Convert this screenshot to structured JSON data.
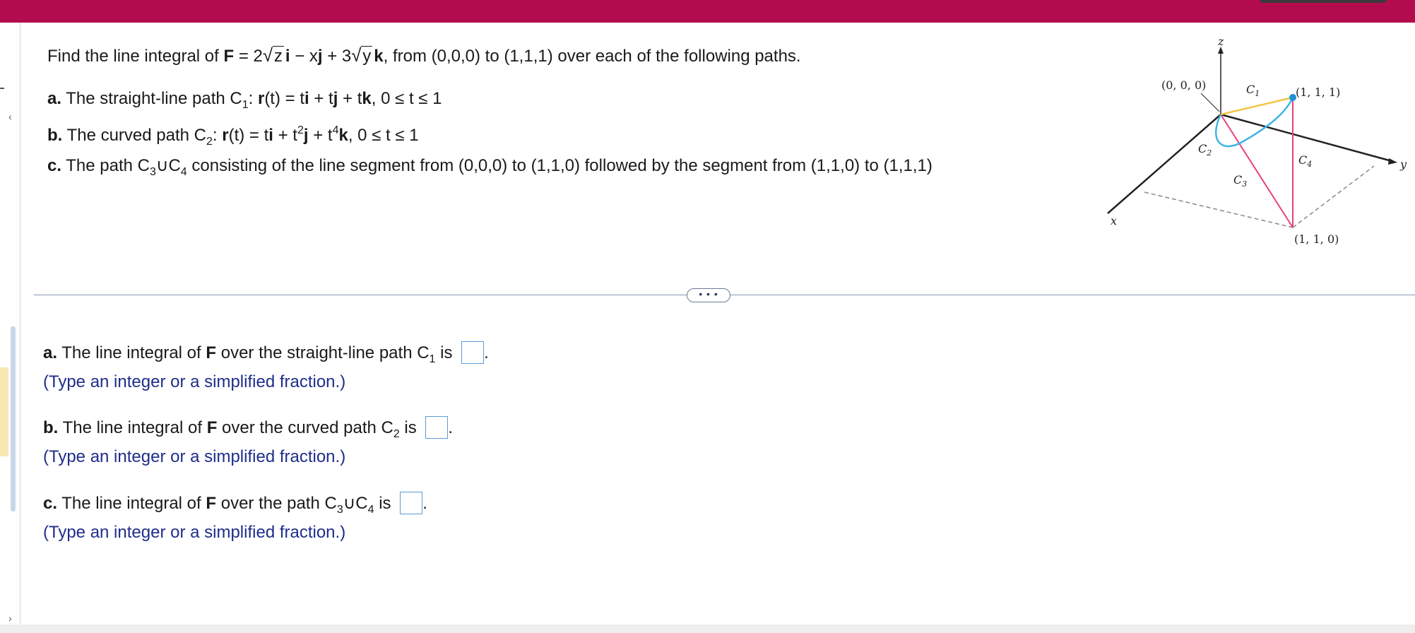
{
  "problem": {
    "intro_pre": "Find the line integral of ",
    "F": "F",
    "eq_a": " = 2",
    "rad_z": "z",
    "i": "i",
    "eq_b": " − x",
    "j": "j",
    "eq_c": " + 3",
    "rad_y": "y",
    "k": "k",
    "intro_post": ", from (0,0,0) to (1,1,1) over each of the following paths.",
    "a_label": "a.",
    "a_text1": " The straight-line path C",
    "a_sub": "1",
    "a_text2": ": ",
    "a_r": "r",
    "a_text3": "(t) = t",
    "a_i": "i",
    "a_text4": " + t",
    "a_j": "j",
    "a_text5": " + t",
    "a_k": "k",
    "a_text6": ", 0 ≤ t ≤ 1",
    "b_label": "b.",
    "b_text1": " The curved path C",
    "b_sub": "2",
    "b_text2": ": ",
    "b_r": "r",
    "b_text3": "(t) = t",
    "b_i": "i",
    "b_text4": " + t",
    "b_sup2": "2",
    "b_j": "j",
    "b_text5": " + t",
    "b_sup4": "4",
    "b_k": "k",
    "b_text6": ", 0 ≤ t ≤ 1",
    "c_label": "c.",
    "c_text1": " The path C",
    "c_sub3": "3",
    "c_union": "∪C",
    "c_sub4": "4",
    "c_text2": " consisting of the line segment from (0,0,0) to (1,1,0) followed by the segment from (1,1,0) to (1,1,1)"
  },
  "more_button": "• • •",
  "answers": {
    "a_label": "a.",
    "a_text1": " The line integral of ",
    "a_F": "F",
    "a_text2": " over the straight-line path C",
    "a_sub": "1",
    "a_text3": " is ",
    "b_label": "b.",
    "b_text1": " The line integral of ",
    "b_F": "F",
    "b_text2": " over the curved path C",
    "b_sub": "2",
    "b_text3": " is ",
    "c_label": "c.",
    "c_text1": " The line integral of ",
    "c_F": "F",
    "c_text2": " over the path C",
    "c_sub3": "3",
    "c_union": "∪C",
    "c_sub4": "4",
    "c_text3": " is ",
    "period": ".",
    "hint": "(Type an integer or a simplified fraction.)"
  },
  "figure": {
    "z": "z",
    "y": "y",
    "x": "x",
    "origin": "(0, 0, 0)",
    "p111": "(1, 1, 1)",
    "p110": "(1, 1, 0)",
    "c1": "C",
    "c1s": "1",
    "c2": "C",
    "c2s": "2",
    "c3": "C",
    "c3s": "3",
    "c4": "C",
    "c4s": "4"
  },
  "colors": {
    "topbar": "#b30c4e",
    "c1_line": "#f5c542",
    "c2_curve": "#3fb4e6",
    "c3_c4_line": "#e8407f",
    "hint_text": "#1f2e8a",
    "answer_box": "#5b9bd5"
  }
}
